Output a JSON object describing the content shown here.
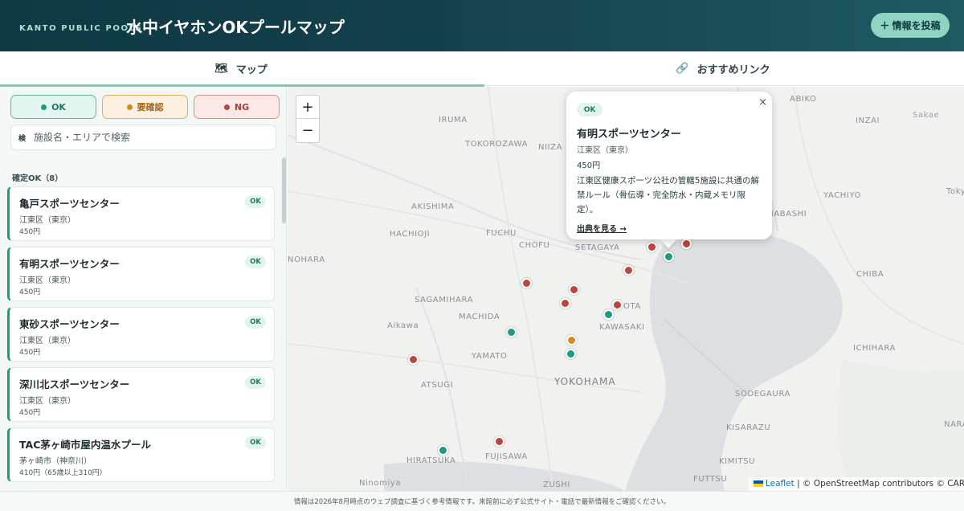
{
  "header": {
    "brand_sub": "KANTO PUBLIC POOLS",
    "title": "水中イヤホンOKプールマップ",
    "post_button": "＋ 情報を投稿"
  },
  "tabs": [
    {
      "icon": "map-icon",
      "label": "マップ",
      "active": true
    },
    {
      "icon": "link-icon",
      "label": "おすすめリンク",
      "active": false
    }
  ],
  "sidebar": {
    "filters": [
      {
        "label": "OK",
        "status": "ok"
      },
      {
        "label": "要確認",
        "status": "check"
      },
      {
        "label": "NG",
        "status": "ng"
      }
    ],
    "search_icon": "検",
    "search_placeholder": "施設名・エリアで検索",
    "section_label": "確定OK（8）",
    "items": [
      {
        "name": "亀戸スポーツセンター",
        "area": "江東区（東京）",
        "price": "450円",
        "badge": "OK"
      },
      {
        "name": "有明スポーツセンター",
        "area": "江東区（東京）",
        "price": "450円",
        "badge": "OK"
      },
      {
        "name": "東砂スポーツセンター",
        "area": "江東区（東京）",
        "price": "450円",
        "badge": "OK"
      },
      {
        "name": "深川北スポーツセンター",
        "area": "江東区（東京）",
        "price": "450円",
        "badge": "OK"
      },
      {
        "name": "TAC茅ヶ崎市屋内温水プール",
        "area": "茅ヶ崎市（神奈川）",
        "price": "410円（65歳以上310円）",
        "badge": "OK"
      }
    ]
  },
  "map": {
    "zoom_in": "+",
    "zoom_out": "−",
    "places": [
      "IRUMA",
      "TOKOROZAWA",
      "NIIZA",
      "AKISHIMA",
      "HACHIOJI",
      "FUCHU",
      "CHOFU",
      "SETAGAYA",
      "NOHARA",
      "SAGAMIHARA",
      "MACHIDA",
      "OTA",
      "KAWASAKI",
      "Aikawa",
      "YAMATO",
      "YOKOHAMA",
      "ATSUGI",
      "HIRATSUKA",
      "FUJISAWA",
      "Ninomiya",
      "ZUSHI",
      "ABIKO",
      "INZAI",
      "Sakae",
      "YACHIYO",
      "FUNABASHI",
      "CHIBA",
      "ICHIHARA",
      "SODEGAURA",
      "KISARAZU",
      "KIMITSU",
      "FUTTSU",
      "NARA",
      "Tokyo Bay"
    ],
    "popup": {
      "badge": "OK",
      "close": "×",
      "name": "有明スポーツセンター",
      "area": "江東区（東京）",
      "price": "450円",
      "description": "江東区健康スポーツ公社の管轄5施設に共通の解禁ルール（骨伝導・完全防水・内蔵メモリ限定）。",
      "link": "出典を見る →"
    },
    "attribution_leaflet": "Leaflet",
    "attribution_rest": " | © OpenStreetMap contributors © CARTO"
  },
  "footer": {
    "notice": "情報は2026年8月時点のウェブ調査に基づく参考情報です。来館前に必ず公式サイト・電話で最新情報をご確認ください。"
  },
  "colors": {
    "ok": "#1f9a7e",
    "check": "#d48a23",
    "ng": "#b9463f",
    "header_bg": "#14404c",
    "accent": "#8fd3c3"
  }
}
